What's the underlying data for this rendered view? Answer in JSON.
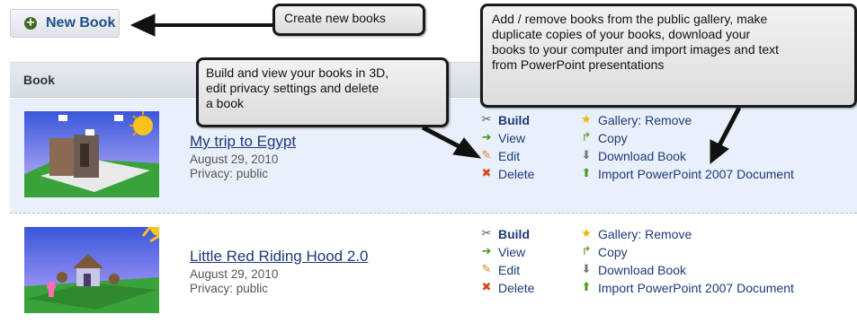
{
  "toolbar": {
    "new_book_label": "New Book",
    "new_book_icon": "plus-circle-icon"
  },
  "table": {
    "header": "Book"
  },
  "books": [
    {
      "title": "My trip to Egypt",
      "date": "August 29, 2010",
      "privacy": "Privacy: public",
      "actions": {
        "build": "Build",
        "view": "View",
        "edit": "Edit",
        "delete": "Delete"
      },
      "more": {
        "gallery": "Gallery: Remove",
        "copy": "Copy",
        "download": "Download Book",
        "import": "Import PowerPoint 2007 Document"
      }
    },
    {
      "title": "Little Red Riding Hood 2.0",
      "date": "August 29, 2010",
      "privacy": "Privacy: public",
      "actions": {
        "build": "Build",
        "view": "View",
        "edit": "Edit",
        "delete": "Delete"
      },
      "more": {
        "gallery": "Gallery: Remove",
        "copy": "Copy",
        "download": "Download Book",
        "import": "Import PowerPoint 2007 Document"
      }
    }
  ],
  "callouts": {
    "create": "Create new books",
    "build_lines": [
      "Build and view your books in 3D,",
      "edit privacy settings and delete",
      "a book"
    ],
    "gallery_lines": [
      "Add / remove books from the public gallery, make",
      "duplicate copies of your books, download your",
      "books to your computer and import images and text",
      "from PowerPoint presentations"
    ]
  }
}
